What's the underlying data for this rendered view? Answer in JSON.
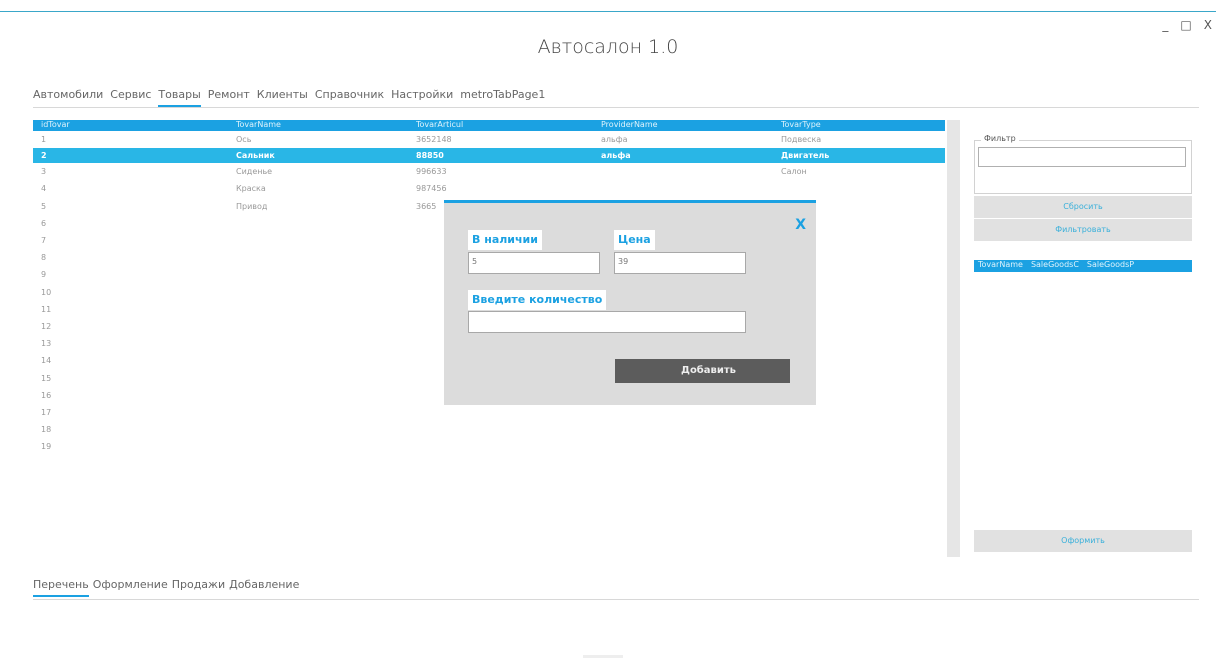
{
  "window": {
    "title": "Автосалон 1.0",
    "controls": {
      "minimize": "_",
      "maximize": "□",
      "close": "X"
    }
  },
  "top_tabs": [
    {
      "label": "Автомобили",
      "active": false
    },
    {
      "label": "Сервис",
      "active": false
    },
    {
      "label": "Товары",
      "active": true
    },
    {
      "label": "Ремонт",
      "active": false
    },
    {
      "label": "Клиенты",
      "active": false
    },
    {
      "label": "Справочник",
      "active": false
    },
    {
      "label": "Настройки",
      "active": false
    },
    {
      "label": "metroTabPage1",
      "active": false
    }
  ],
  "grid": {
    "columns": [
      "idTovar",
      "TovarName",
      "TovarArticul",
      "ProviderName",
      "TovarType"
    ],
    "rows": [
      {
        "id": "1",
        "name": "Ось",
        "articul": "3652148",
        "provider": "альфа",
        "type": "Подвеска",
        "selected": false
      },
      {
        "id": "2",
        "name": "Сальник",
        "articul": "88850",
        "provider": "альфа",
        "type": "Двигатель",
        "selected": true
      },
      {
        "id": "3",
        "name": "Сиденье",
        "articul": "996633",
        "provider": "",
        "type": "Салон",
        "selected": false
      },
      {
        "id": "4",
        "name": "Краска",
        "articul": "987456",
        "provider": "",
        "type": "",
        "selected": false
      },
      {
        "id": "5",
        "name": "Привод",
        "articul": "3665",
        "provider": "",
        "type": "",
        "selected": false
      },
      {
        "id": "6",
        "name": "",
        "articul": "",
        "provider": "",
        "type": "",
        "selected": false
      },
      {
        "id": "7",
        "name": "",
        "articul": "",
        "provider": "",
        "type": "",
        "selected": false
      },
      {
        "id": "8",
        "name": "",
        "articul": "",
        "provider": "",
        "type": "",
        "selected": false
      },
      {
        "id": "9",
        "name": "",
        "articul": "",
        "provider": "",
        "type": "",
        "selected": false
      },
      {
        "id": "10",
        "name": "",
        "articul": "",
        "provider": "",
        "type": "",
        "selected": false
      },
      {
        "id": "11",
        "name": "",
        "articul": "",
        "provider": "",
        "type": "",
        "selected": false
      },
      {
        "id": "12",
        "name": "",
        "articul": "",
        "provider": "",
        "type": "",
        "selected": false
      },
      {
        "id": "13",
        "name": "",
        "articul": "",
        "provider": "",
        "type": "",
        "selected": false
      },
      {
        "id": "14",
        "name": "",
        "articul": "",
        "provider": "",
        "type": "",
        "selected": false
      },
      {
        "id": "15",
        "name": "",
        "articul": "",
        "provider": "",
        "type": "",
        "selected": false
      },
      {
        "id": "16",
        "name": "",
        "articul": "",
        "provider": "",
        "type": "",
        "selected": false
      },
      {
        "id": "17",
        "name": "",
        "articul": "",
        "provider": "",
        "type": "",
        "selected": false
      },
      {
        "id": "18",
        "name": "",
        "articul": "",
        "provider": "",
        "type": "",
        "selected": false
      },
      {
        "id": "19",
        "name": "",
        "articul": "",
        "provider": "",
        "type": "",
        "selected": false
      }
    ]
  },
  "side_panel": {
    "filter_label": "Фильтр",
    "filter_value": "",
    "reset_button": "Сбросить",
    "filter_button": "Фильтровать",
    "cart_columns": [
      "TovarName",
      "SaleGoodsC",
      "SaleGoodsP"
    ],
    "checkout_button": "Оформить"
  },
  "modal": {
    "close": "X",
    "stock_label": "В наличии",
    "stock_value": "5",
    "price_label": "Цена",
    "price_value": "39",
    "qty_label": "Введите количество",
    "qty_value": "",
    "add_button": "Добавить"
  },
  "bottom_tabs": [
    {
      "label": "Перечень",
      "active": true
    },
    {
      "label": "Оформление",
      "active": false
    },
    {
      "label": "Продажи",
      "active": false
    },
    {
      "label": "Добавление",
      "active": false
    }
  ],
  "colors": {
    "accent": "#1ba1e2",
    "selected_row": "#29b6e6",
    "dialog_bg": "#dcdcdc",
    "add_button": "#5c5c5c"
  }
}
